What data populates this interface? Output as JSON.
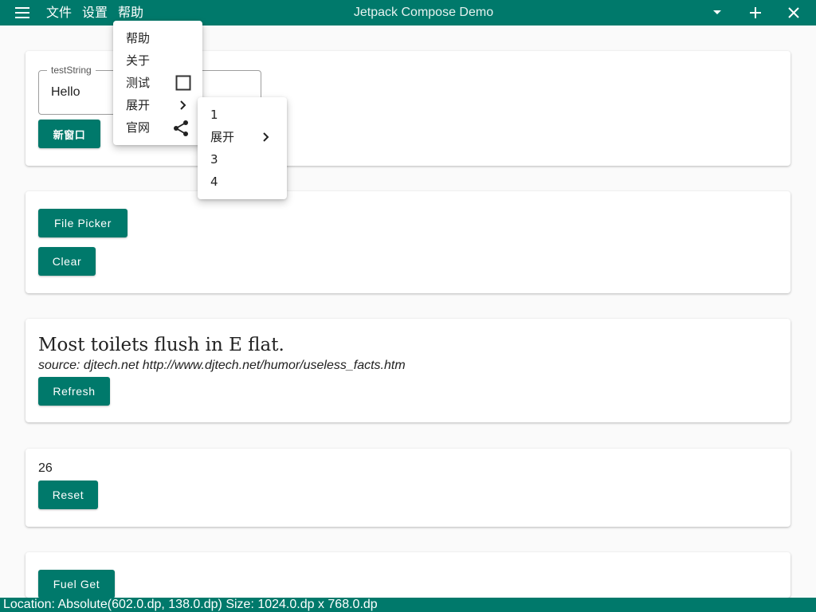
{
  "appbar": {
    "title": "Jetpack Compose Demo",
    "menus": [
      "文件",
      "设置",
      "帮助"
    ],
    "icons": [
      "menu-icon",
      "chevron-down-icon",
      "plus-icon",
      "close-icon"
    ]
  },
  "colors": {
    "primary": "#00796b",
    "surface": "#ffffff",
    "background": "#fafafa"
  },
  "card1": {
    "field_label": "testString",
    "field_value": "Hello",
    "new_window_button": "新窗口"
  },
  "card2": {
    "file_picker_button": "File Picker",
    "clear_button": "Clear"
  },
  "card3": {
    "fact": "Most toilets flush in E flat.",
    "source": "source: djtech.net http://www.djtech.net/humor/useless_facts.htm",
    "refresh_button": "Refresh"
  },
  "card4": {
    "count": "26",
    "reset_button": "Reset"
  },
  "card5": {
    "fuel_get_button": "Fuel Get"
  },
  "help_menu": {
    "items": [
      {
        "label": "帮助"
      },
      {
        "label": "关于"
      },
      {
        "label": "测试",
        "icon": "checkbox-icon",
        "checked": false
      },
      {
        "label": "展开",
        "icon": "chevron-right-icon"
      },
      {
        "label": "官网",
        "icon": "share-icon"
      }
    ]
  },
  "submenu": {
    "items": [
      {
        "label": "1"
      },
      {
        "label": "展开",
        "icon": "chevron-right-icon"
      },
      {
        "label": "3"
      },
      {
        "label": "4"
      }
    ]
  },
  "status_bar": {
    "text": "Location: Absolute(602.0.dp, 138.0.dp) Size: 1024.0.dp x 768.0.dp"
  }
}
